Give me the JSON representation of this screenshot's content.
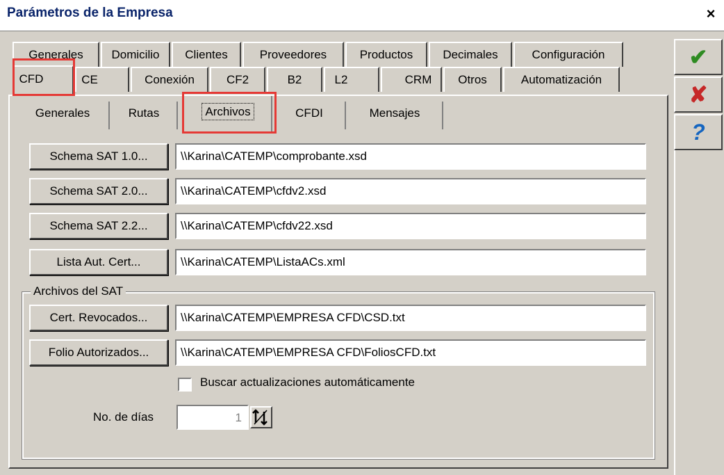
{
  "window": {
    "title": "Parámetros de la Empresa",
    "close_label": "×"
  },
  "tabs_row1": [
    "Generales",
    "Domicilio",
    "Clientes",
    "Proveedores",
    "Productos",
    "Decimales",
    "Configuración"
  ],
  "tabs_row2": [
    "CFD",
    "CE",
    "Conexión",
    "CF2",
    "B2",
    "L2",
    "CRM",
    "Otros",
    "Automatización"
  ],
  "subtabs": [
    "Generales",
    "Rutas",
    "Archivos",
    "CFDI",
    "Mensajes"
  ],
  "schema_rows": [
    {
      "button": "Schema SAT 1.0...",
      "path": "\\\\Karina\\CATEMP\\comprobante.xsd"
    },
    {
      "button": "Schema SAT 2.0...",
      "path": "\\\\Karina\\CATEMP\\cfdv2.xsd"
    },
    {
      "button": "Schema SAT 2.2...",
      "path": "\\\\Karina\\CATEMP\\cfdv22.xsd"
    },
    {
      "button": "Lista Aut. Cert...",
      "path": "\\\\Karina\\CATEMP\\ListaACs.xml"
    }
  ],
  "sat_group": {
    "label": "Archivos del SAT",
    "rows": [
      {
        "button": "Cert. Revocados...",
        "path": "\\\\Karina\\CATEMP\\EMPRESA CFD\\CSD.txt"
      },
      {
        "button": "Folio Autorizados...",
        "path": "\\\\Karina\\CATEMP\\EMPRESA CFD\\FoliosCFD.txt"
      }
    ],
    "checkbox_label": "Buscar actualizaciones automáticamente",
    "checkbox_checked": false,
    "days_label": "No. de días",
    "days_value": "1"
  },
  "side_buttons": [
    {
      "icon": "check-icon",
      "glyph": "✔",
      "color": "#2e8b22"
    },
    {
      "icon": "cancel-icon",
      "glyph": "✘",
      "color": "#c62828"
    },
    {
      "icon": "help-icon",
      "glyph": "?",
      "color": "#1565c0"
    }
  ],
  "highlight_color": "#e53935"
}
